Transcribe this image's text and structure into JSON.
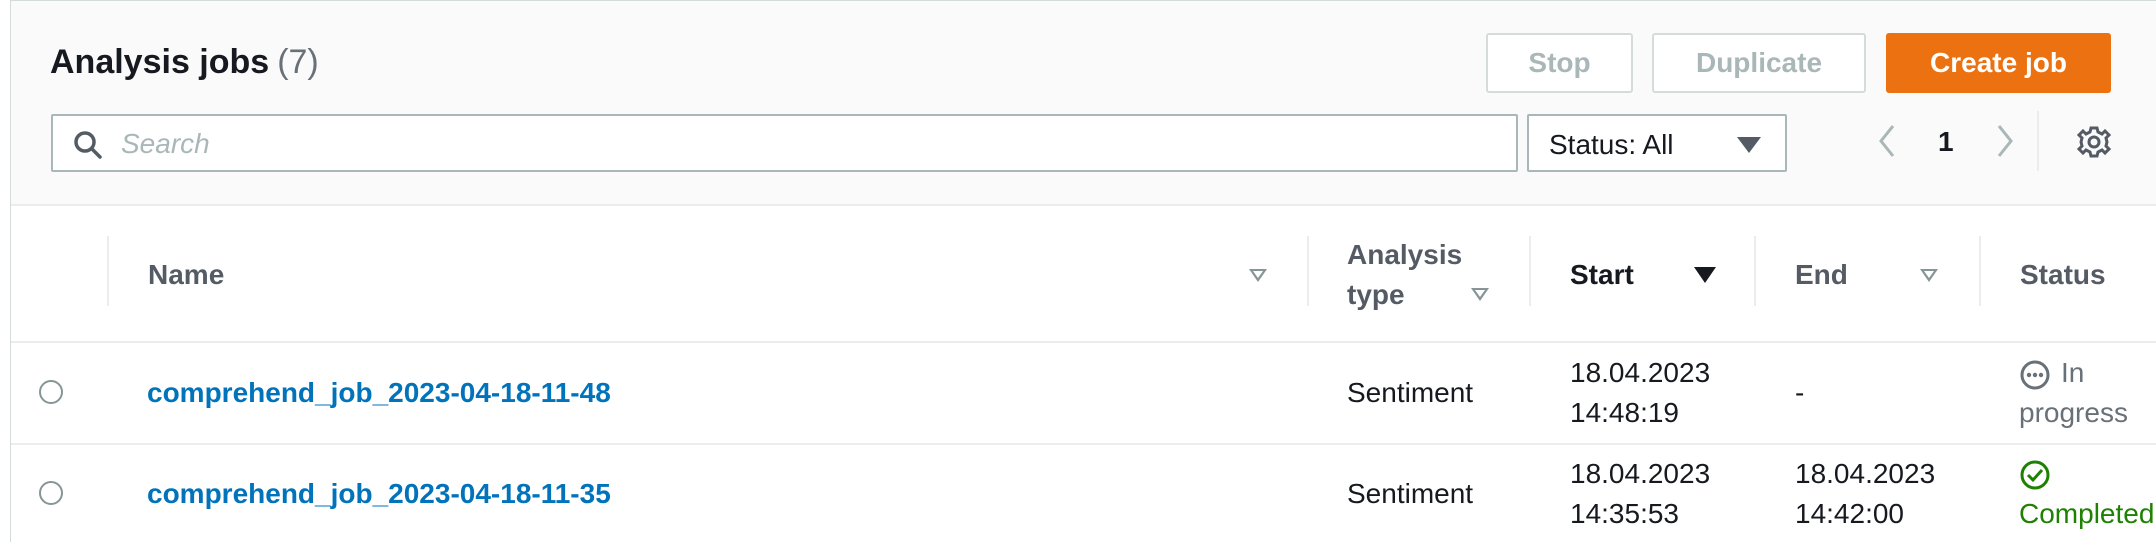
{
  "header": {
    "title": "Analysis jobs",
    "count": "(7)",
    "buttons": {
      "stop": "Stop",
      "duplicate": "Duplicate",
      "create": "Create job"
    }
  },
  "filter": {
    "search_placeholder": "Search",
    "status_select": "Status: All"
  },
  "pagination": {
    "current_page": "1"
  },
  "columns": {
    "name": "Name",
    "analysis_type_line1": "Analysis",
    "analysis_type_line2": "type",
    "start": "Start",
    "end": "End",
    "status": "Status"
  },
  "rows": [
    {
      "name": "comprehend_job_2023-04-18-11-48",
      "analysis_type": "Sentiment",
      "start_date": "18.04.2023",
      "start_time": "14:48:19",
      "end": "-",
      "status_line1": "In",
      "status_line2": "progress",
      "status_icon": "in-progress-icon"
    },
    {
      "name": "comprehend_job_2023-04-18-11-35",
      "analysis_type": "Sentiment",
      "start_date": "18.04.2023",
      "start_time": "14:35:53",
      "end_date": "18.04.2023",
      "end_time": "14:42:00",
      "status_line1": "Completed",
      "status_icon": "check-circle-icon"
    }
  ],
  "colors": {
    "primary_button": "#ec7211",
    "link": "#0073bb",
    "success": "#1d8102",
    "muted": "#687078"
  }
}
